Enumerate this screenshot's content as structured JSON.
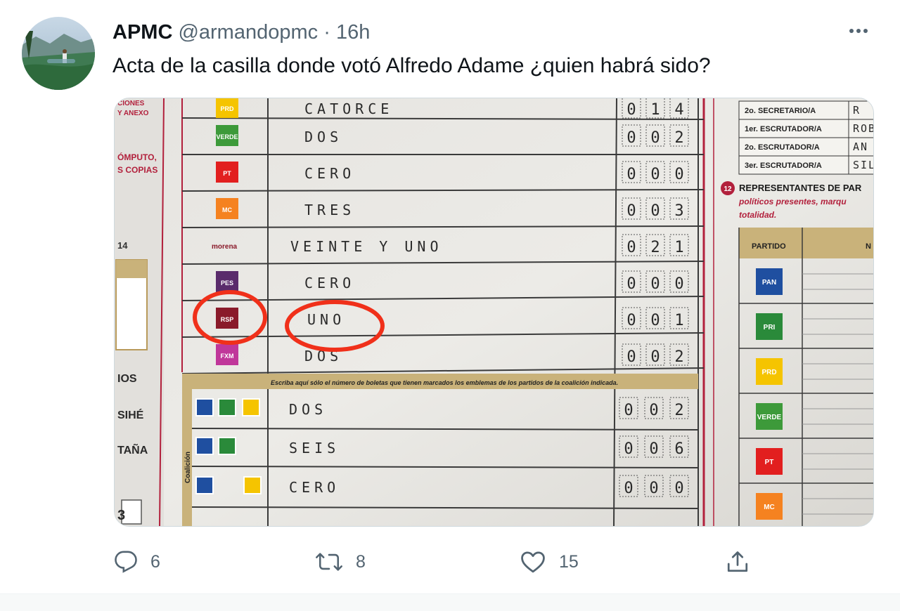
{
  "tweet": {
    "author_name": "APMC",
    "handle": "@armandopmc",
    "separator": "·",
    "time": "16h",
    "text": "Acta de la casilla donde votó Alfredo Adame ¿quien habrá sido?"
  },
  "media": {
    "left_margin": [
      "CIONES",
      "Y ANEXO",
      "ÓMPUTO,",
      "S COPIAS",
      "14",
      "IOS",
      "SIHÉ",
      "TAÑA",
      "3"
    ],
    "party_rows": [
      {
        "logo": "PRD",
        "word": "CATORCE",
        "digits": [
          "0",
          "1",
          "4"
        ]
      },
      {
        "logo": "VERDE",
        "word": "DOS",
        "digits": [
          "0",
          "0",
          "2"
        ]
      },
      {
        "logo": "PT",
        "word": "CERO",
        "digits": [
          "0",
          "0",
          "0"
        ]
      },
      {
        "logo": "MC",
        "word": "TRES",
        "digits": [
          "0",
          "0",
          "3"
        ]
      },
      {
        "logo": "morena",
        "word": "VEINTE Y UNO",
        "digits": [
          "0",
          "2",
          "1"
        ]
      },
      {
        "logo": "PES",
        "word": "CERO",
        "digits": [
          "0",
          "0",
          "0"
        ]
      },
      {
        "logo": "RSP",
        "word": "UNO",
        "digits": [
          "0",
          "0",
          "1"
        ],
        "circled": true
      },
      {
        "logo": "FXM",
        "word": "DOS",
        "digits": [
          "0",
          "0",
          "2"
        ]
      }
    ],
    "coalition_caption": "Escriba aquí sólo el número de boletas que tienen marcados los emblemas de los partidos de la coalición indicada.",
    "coalition_label": "Coalición",
    "coalition_rows": [
      {
        "word": "DOS",
        "digits": [
          "0",
          "0",
          "2"
        ]
      },
      {
        "word": "SEIS",
        "digits": [
          "0",
          "0",
          "6"
        ]
      },
      {
        "word": "CERO",
        "digits": [
          "0",
          "0",
          "0"
        ]
      }
    ],
    "officials": [
      {
        "role": "2o. SECRETARIO/A",
        "name": "R"
      },
      {
        "role": "1er. ESCRUTADOR/A",
        "name": "ROB"
      },
      {
        "role": "2o. ESCRUTADOR/A",
        "name": "AN"
      },
      {
        "role": "3er. ESCRUTADOR/A",
        "name": "SIL"
      }
    ],
    "section_number": "12",
    "section_title": "REPRESENTANTES DE PAR",
    "section_note_1": "políticos presentes, marqu",
    "section_note_2": "totalidad.",
    "table_header": "PARTIDO",
    "table_header_2": "N",
    "table_parties": [
      "PAN",
      "PRI",
      "PRD",
      "VERDE",
      "PT",
      "MC"
    ]
  },
  "actions": {
    "reply_count": "6",
    "retweet_count": "8",
    "like_count": "15"
  },
  "colors": {
    "text_primary": "#0f1419",
    "text_secondary": "#536471",
    "circle_red": "#f0301a",
    "form_maroon": "#b2203c"
  }
}
